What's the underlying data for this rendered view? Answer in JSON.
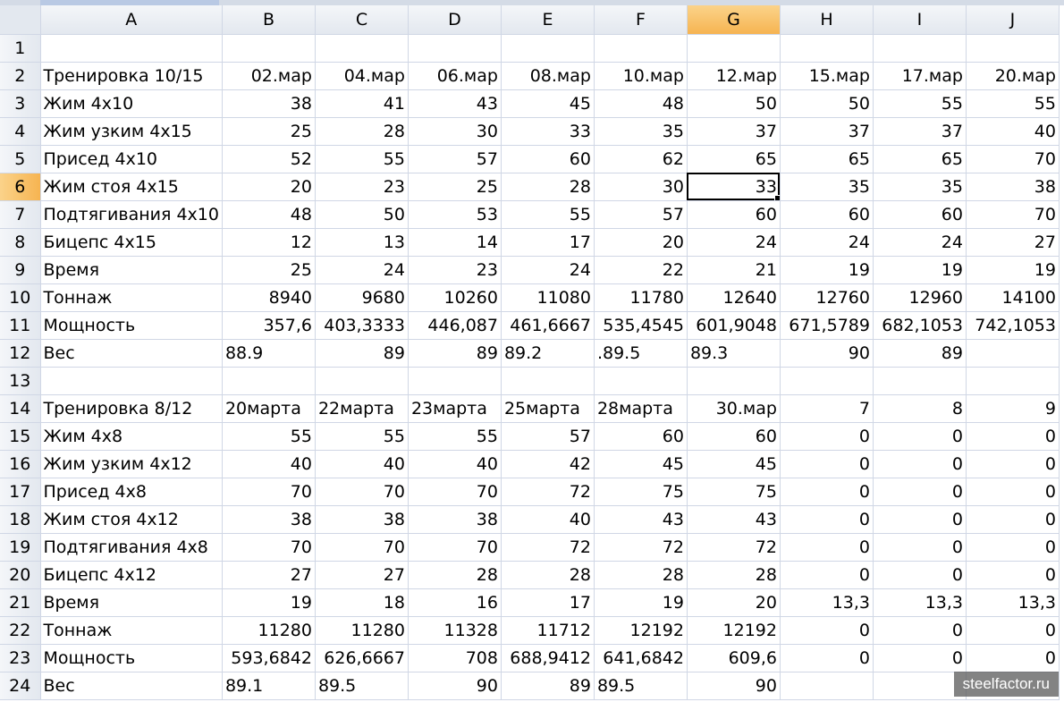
{
  "columns": [
    "A",
    "B",
    "C",
    "D",
    "E",
    "F",
    "G",
    "H",
    "I",
    "J"
  ],
  "active_column": "G",
  "active_row": "6",
  "selected_cell": "G6",
  "rows": [
    {
      "n": "1",
      "cells": [
        "",
        "",
        "",
        "",
        "",
        "",
        "",
        "",
        "",
        ""
      ]
    },
    {
      "n": "2",
      "cells": [
        "Тренировка 10/15",
        "02.мар",
        "04.мар",
        "06.мар",
        "08.мар",
        "10.мар",
        "12.мар",
        "15.мар",
        "17.мар",
        "20.мар"
      ]
    },
    {
      "n": "3",
      "cells": [
        "Жим 4х10",
        "38",
        "41",
        "43",
        "45",
        "48",
        "50",
        "50",
        "55",
        "55"
      ]
    },
    {
      "n": "4",
      "cells": [
        "Жим узким 4х15",
        "25",
        "28",
        "30",
        "33",
        "35",
        "37",
        "37",
        "37",
        "40"
      ]
    },
    {
      "n": "5",
      "cells": [
        "Присед 4х10",
        "52",
        "55",
        "57",
        "60",
        "62",
        "65",
        "65",
        "65",
        "70"
      ]
    },
    {
      "n": "6",
      "cells": [
        "Жим стоя 4х15",
        "20",
        "23",
        "25",
        "28",
        "30",
        "33",
        "35",
        "35",
        "38"
      ]
    },
    {
      "n": "7",
      "cells": [
        "Подтягивания 4х10",
        "48",
        "50",
        "53",
        "55",
        "57",
        "60",
        "60",
        "60",
        "70"
      ]
    },
    {
      "n": "8",
      "cells": [
        "Бицепс 4х15",
        "12",
        "13",
        "14",
        "17",
        "20",
        "24",
        "24",
        "24",
        "27"
      ]
    },
    {
      "n": "9",
      "cells": [
        "Время",
        "25",
        "24",
        "23",
        "24",
        "22",
        "21",
        "19",
        "19",
        "19"
      ]
    },
    {
      "n": "10",
      "cells": [
        "Тоннаж",
        "8940",
        "9680",
        "10260",
        "11080",
        "11780",
        "12640",
        "12760",
        "12960",
        "14100"
      ]
    },
    {
      "n": "11",
      "cells": [
        "Мощность",
        "357,6",
        "403,3333",
        "446,087",
        "461,6667",
        "535,4545",
        "601,9048",
        "671,5789",
        "682,1053",
        "742,1053"
      ]
    },
    {
      "n": "12",
      "cells": [
        "Вес",
        "88.9",
        "89",
        "89",
        "89.2",
        ".89.5",
        "89.3",
        "90",
        "89",
        ""
      ]
    },
    {
      "n": "13",
      "cells": [
        "",
        "",
        "",
        "",
        "",
        "",
        "",
        "",
        "",
        ""
      ]
    },
    {
      "n": "14",
      "cells": [
        "Тренировка 8/12",
        "20марта",
        "22марта",
        "23марта",
        "25марта",
        "28марта",
        "30.мар",
        "7",
        "8",
        "9"
      ]
    },
    {
      "n": "15",
      "cells": [
        "Жим 4х8",
        "55",
        "55",
        "55",
        "57",
        "60",
        "60",
        "0",
        "0",
        "0"
      ]
    },
    {
      "n": "16",
      "cells": [
        "Жим узким 4х12",
        "40",
        "40",
        "40",
        "42",
        "45",
        "45",
        "0",
        "0",
        "0"
      ]
    },
    {
      "n": "17",
      "cells": [
        "Присед 4х8",
        "70",
        "70",
        "70",
        "72",
        "75",
        "75",
        "0",
        "0",
        "0"
      ]
    },
    {
      "n": "18",
      "cells": [
        "Жим стоя 4х12",
        "38",
        "38",
        "38",
        "40",
        "43",
        "43",
        "0",
        "0",
        "0"
      ]
    },
    {
      "n": "19",
      "cells": [
        "Подтягивания 4х8",
        "70",
        "70",
        "70",
        "72",
        "72",
        "72",
        "0",
        "0",
        "0"
      ]
    },
    {
      "n": "20",
      "cells": [
        "Бицепс 4х12",
        "27",
        "27",
        "28",
        "28",
        "28",
        "28",
        "0",
        "0",
        "0"
      ]
    },
    {
      "n": "21",
      "cells": [
        "Время",
        "19",
        "18",
        "16",
        "17",
        "19",
        "20",
        "13,3",
        "13,3",
        "13,3"
      ]
    },
    {
      "n": "22",
      "cells": [
        "Тоннаж",
        "11280",
        "11280",
        "11328",
        "11712",
        "12192",
        "12192",
        "0",
        "0",
        "0"
      ]
    },
    {
      "n": "23",
      "cells": [
        "Мощность",
        "593,6842",
        "626,6667",
        "708",
        "688,9412",
        "641,6842",
        "609,6",
        "0",
        "0",
        "0"
      ]
    },
    {
      "n": "24",
      "cells": [
        "Вес",
        "89.1",
        "89.5",
        "90",
        "89",
        "89.5",
        "90",
        "",
        "",
        ""
      ]
    }
  ],
  "text_cells_left_aligned": {
    "12": [
      1,
      4,
      5,
      6
    ],
    "14": [
      1,
      2,
      3,
      4,
      5
    ],
    "24": [
      1,
      2,
      5
    ]
  },
  "watermark": "steelfactor.ru"
}
